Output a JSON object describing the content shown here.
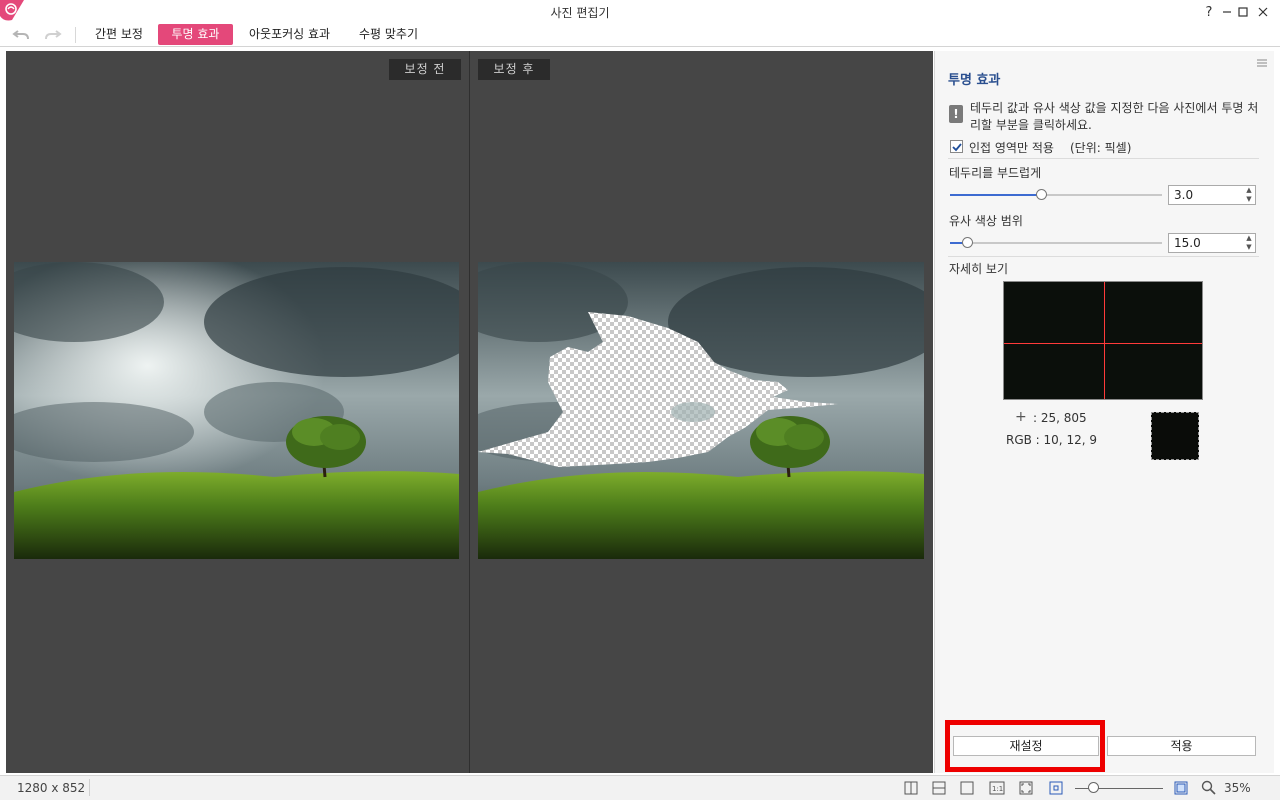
{
  "window": {
    "title": "사진 편집기",
    "help": "?",
    "minimize": "—",
    "maximize": "☐",
    "close": "✕"
  },
  "toolbar": {
    "undo_icon": "undo-icon",
    "redo_icon": "redo-icon",
    "tabs": [
      {
        "label": "간편 보정",
        "active": false
      },
      {
        "label": "투명 효과",
        "active": true
      },
      {
        "label": "아웃포커싱 효과",
        "active": false
      },
      {
        "label": "수평 맞추기",
        "active": false
      }
    ]
  },
  "canvas": {
    "before_label": "보정 전",
    "after_label": "보정 후"
  },
  "panel": {
    "title": "투명 효과",
    "info": "테두리 값과 유사 색상 값을 지정한 다음 사진에서 투명 처리할 부분을 클릭하세요.",
    "adjacent_label": "인접 영역만 적용",
    "adjacent_checked": true,
    "unit_label": "(단위: 픽셀)",
    "smooth_label": "테두리를 부드럽게",
    "smooth_value": "3.0",
    "smooth_fraction": 0.43,
    "similar_label": "유사 색상 범위",
    "similar_value": "15.0",
    "similar_fraction": 0.08,
    "detail_label": "자세히 보기",
    "coord_text": ": 25, 805",
    "rgb_text": "RGB : 10, 12, 9",
    "swatch_color": "#0a0c09",
    "reset_label": "재설정",
    "apply_label": "적용"
  },
  "status": {
    "image_size": "1280 x 852",
    "zoom": "35%",
    "zoom_fraction": 0.2
  },
  "colors": {
    "accent_tab": "#e4487a",
    "panel_title": "#2a4f8f",
    "slider_fill": "#3d6bd1",
    "highlight": "#ee0000"
  }
}
